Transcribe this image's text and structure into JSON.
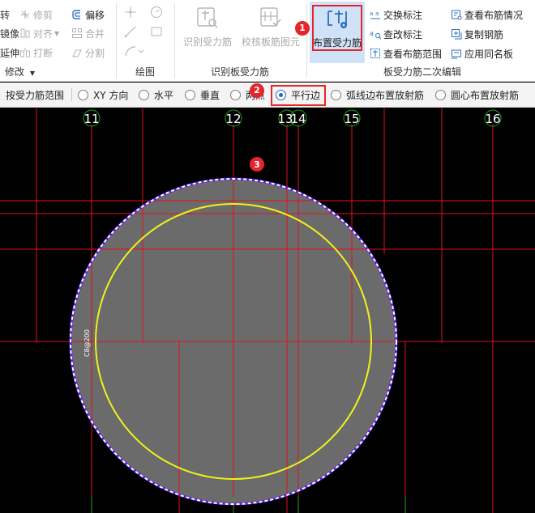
{
  "ribbon": {
    "modify_group": {
      "title": "修改",
      "items": [
        {
          "label": "转",
          "enabled": true
        },
        {
          "label": "修剪",
          "enabled": false
        },
        {
          "label": "偏移",
          "enabled": true
        },
        {
          "label": "镜像",
          "enabled": true
        },
        {
          "label": "对齐",
          "enabled": false
        },
        {
          "label": "合并",
          "enabled": false
        },
        {
          "label": "延伸",
          "enabled": true
        },
        {
          "label": "打断",
          "enabled": false
        },
        {
          "label": "分割",
          "enabled": false
        }
      ]
    },
    "draw_group": {
      "title": "绘图"
    },
    "identify_group": {
      "title": "识别板受力筋",
      "buttons": [
        {
          "label": "识别受力筋"
        },
        {
          "label": "校核板筋图元"
        }
      ]
    },
    "layout_button": {
      "label": "布置受力筋"
    },
    "secondary_group": {
      "title": "板受力筋二次编辑",
      "items": [
        {
          "label": "交换标注"
        },
        {
          "label": "查看布筋情况"
        },
        {
          "label": "查改标注"
        },
        {
          "label": "复制钢筋"
        },
        {
          "label": "查看布筋范围"
        },
        {
          "label": "应用同名板"
        }
      ]
    }
  },
  "optbar": {
    "label": "按受力筋范围",
    "options": [
      {
        "label": "XY 方向",
        "checked": false
      },
      {
        "label": "水平",
        "checked": false
      },
      {
        "label": "垂直",
        "checked": false
      },
      {
        "label": "两点",
        "checked": false
      },
      {
        "label": "平行边",
        "checked": true
      },
      {
        "label": "弧线边布置放射筋",
        "checked": false
      },
      {
        "label": "圆心布置放射筋",
        "checked": false
      }
    ]
  },
  "canvas": {
    "axis_labels": [
      "11",
      "12",
      "13",
      "14",
      "15",
      "16"
    ],
    "slab_annotation": "C8@200"
  },
  "annotations": [
    "1",
    "2",
    "3"
  ],
  "colors": {
    "accent_red": "#e2262b",
    "axis_red": "#e0121b",
    "slab_fill": "#6b6b6b",
    "rebar_yellow": "#f2f21a",
    "axis_green": "#1fa31f",
    "selection_blue": "#cfe2f7",
    "radio_blue": "#2a63c7"
  }
}
